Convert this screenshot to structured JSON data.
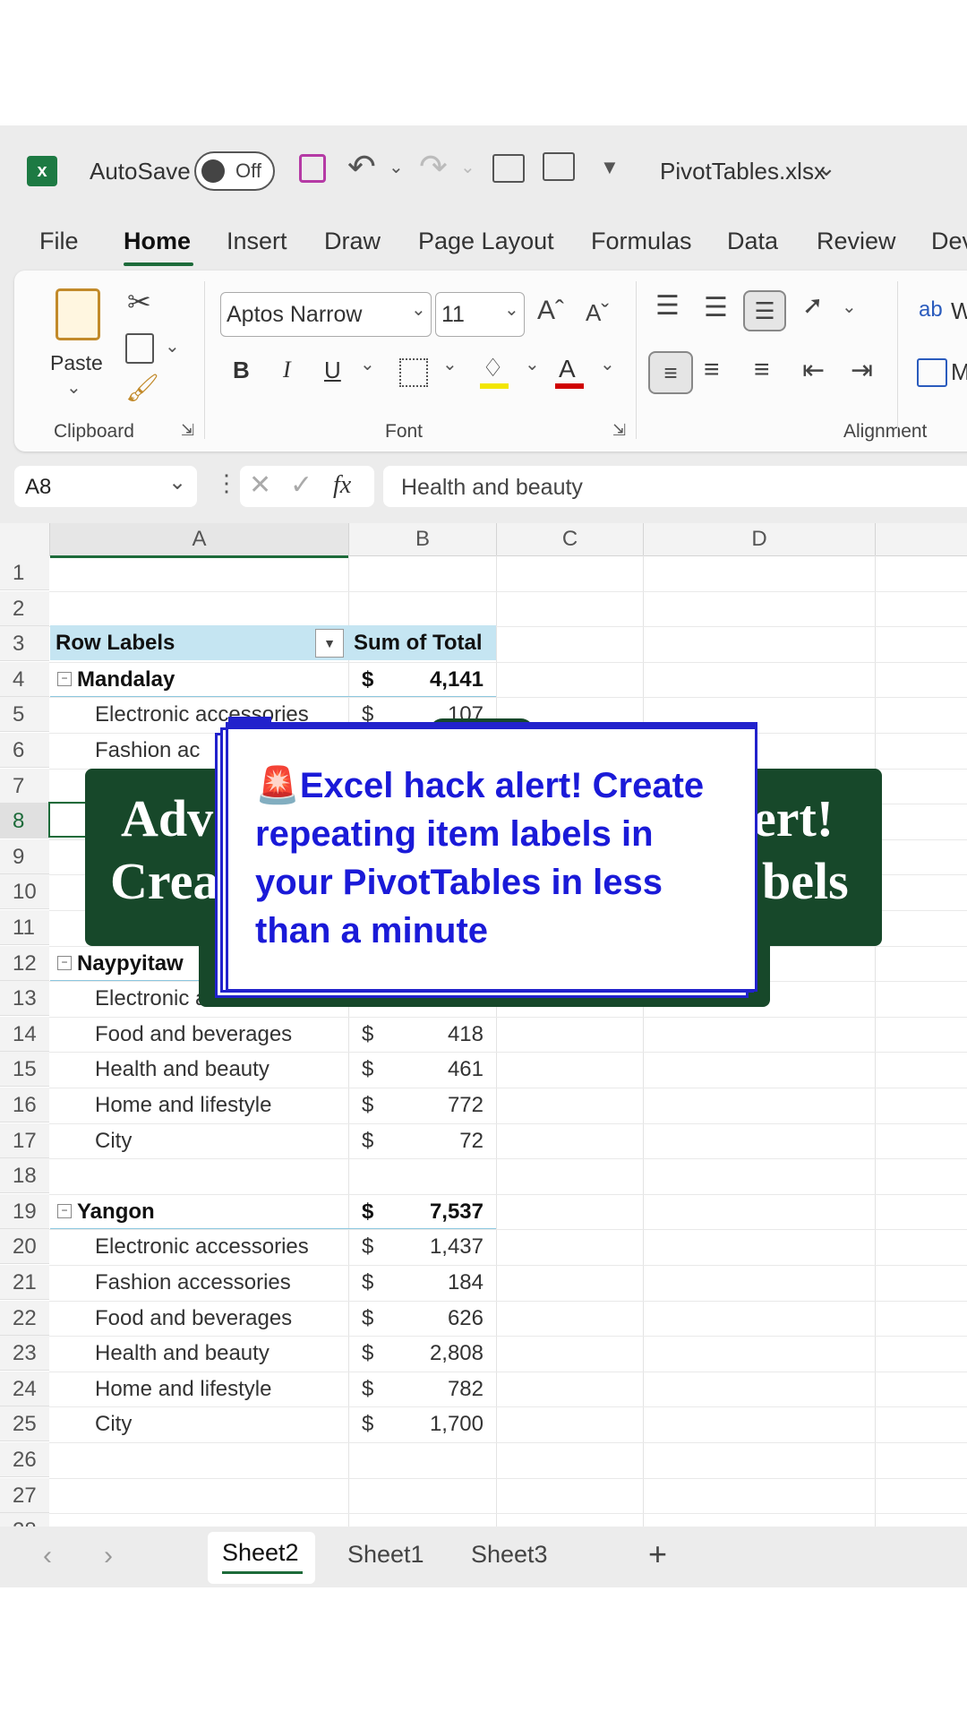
{
  "title_bar": {
    "autosave_label": "AutoSave",
    "autosave_state": "Off",
    "filename": "PivotTables.xlsx"
  },
  "menu_tabs": [
    "File",
    "Home",
    "Insert",
    "Draw",
    "Page Layout",
    "Formulas",
    "Data",
    "Review",
    "Dev"
  ],
  "active_tab": "Home",
  "ribbon": {
    "paste_label": "Paste",
    "clipboard_label": "Clipboard",
    "font_name": "Aptos Narrow",
    "font_size": "11",
    "font_group_label": "Font",
    "alignment_label": "Alignment",
    "bold": "B",
    "italic": "I",
    "underline": "U",
    "grow_font": "Aˆ",
    "shrink_font": "Aˇ",
    "font_color_glyph": "A",
    "wrap_glyph": "ab",
    "wrap_label": "W",
    "merge_label": "M",
    "accent_yellow": "#f2e600",
    "accent_red": "#d00000"
  },
  "formula_bar": {
    "name_box": "A8",
    "fx": "fx",
    "value": "Health and beauty"
  },
  "columns": [
    "A",
    "B",
    "C",
    "D"
  ],
  "rows": [
    "1",
    "2",
    "3",
    "4",
    "5",
    "6",
    "7",
    "8",
    "9",
    "10",
    "11",
    "12",
    "13",
    "14",
    "15",
    "16",
    "17",
    "18",
    "19",
    "20",
    "21",
    "22",
    "23",
    "24",
    "25",
    "26",
    "27",
    "28"
  ],
  "pivot": {
    "header_row_labels": "Row Labels",
    "header_sum": "Sum of Total",
    "currency": "$",
    "cells": [
      {
        "row": 4,
        "label": "Mandalay",
        "value": "4,141",
        "bold": true,
        "group": true
      },
      {
        "row": 5,
        "label": "Electronic accessories",
        "value": "107",
        "bold": false,
        "group": false
      },
      {
        "row": 6,
        "label": "Fashion ac",
        "value": "",
        "bold": false,
        "group": false
      },
      {
        "row": 12,
        "label": "Naypyitaw",
        "value": "",
        "bold": true,
        "group": true
      },
      {
        "row": 13,
        "label": "Electronic accessories",
        "value": "",
        "bold": false,
        "group": false
      },
      {
        "row": 14,
        "label": "Food and beverages",
        "value": "418",
        "bold": false,
        "group": false
      },
      {
        "row": 15,
        "label": "Health and beauty",
        "value": "461",
        "bold": false,
        "group": false
      },
      {
        "row": 16,
        "label": "Home and lifestyle",
        "value": "772",
        "bold": false,
        "group": false
      },
      {
        "row": 17,
        "label": "City",
        "value": "72",
        "bold": false,
        "group": false
      },
      {
        "row": 19,
        "label": "Yangon",
        "value": "7,537",
        "bold": true,
        "group": true
      },
      {
        "row": 20,
        "label": "Electronic accessories",
        "value": "1,437",
        "bold": false,
        "group": false
      },
      {
        "row": 21,
        "label": "Fashion accessories",
        "value": "184",
        "bold": false,
        "group": false
      },
      {
        "row": 22,
        "label": "Food and beverages",
        "value": "626",
        "bold": false,
        "group": false
      },
      {
        "row": 23,
        "label": "Health and beauty",
        "value": "2,808",
        "bold": false,
        "group": false
      },
      {
        "row": 24,
        "label": "Home and lifestyle",
        "value": "782",
        "bold": false,
        "group": false
      },
      {
        "row": 25,
        "label": "City",
        "value": "1,700",
        "bold": false,
        "group": false
      }
    ]
  },
  "sheets": [
    "Sheet2",
    "Sheet1",
    "Sheet3"
  ],
  "active_sheet": "Sheet2",
  "add_sheet": "+",
  "overlay": {
    "banner_line1_left": "Adv",
    "banner_line1_right": "ert!",
    "banner_line2_left": "Crea",
    "banner_line2_right": "bels",
    "card_emoji": "🚨",
    "card_text": "Excel hack alert! Create repeating item labels in your PivotTables in less than a minute",
    "banner_color": "#17482a",
    "card_text_color": "#1a1ad8"
  }
}
